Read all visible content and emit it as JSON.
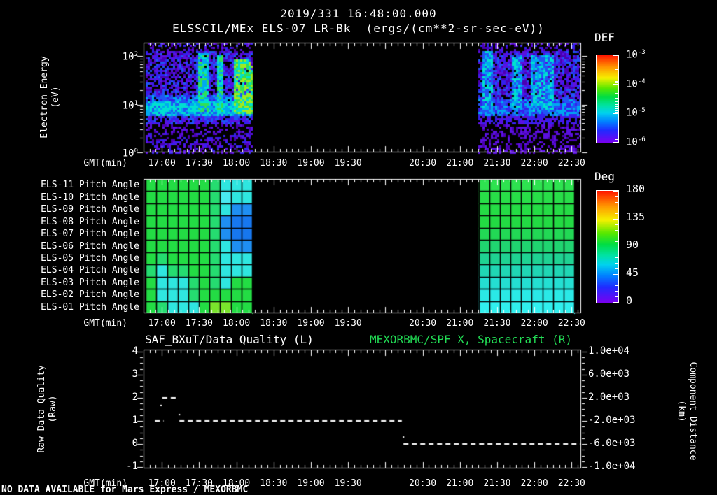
{
  "header": {
    "timestamp": "2019/331 16:48:00.000",
    "dataset": "ELSSCIL/MEx ELS-07 LR-Bk  (ergs/(cm**2-sr-sec-eV))"
  },
  "status_line": "NO DATA AVAILABLE for Mars Express / MEXORBMC",
  "colors": {
    "background": "#000000",
    "text": "#ffffff",
    "accent_green": "#22dd55"
  },
  "chart_data": {
    "time_axis": {
      "xlabel": "GMT(min)",
      "major_start": 0.042,
      "major_step": 0.0851,
      "count": 12,
      "minor_per_major": 6,
      "labels": [
        "17:00",
        "17:30",
        "18:00",
        "18:30",
        "19:00",
        "19:30",
        "",
        "20:30",
        "21:00",
        "21:30",
        "22:00",
        "22:30"
      ]
    },
    "panels": [
      {
        "id": "electron_energy_spectrogram",
        "type": "heatmap",
        "ylabel_lines": [
          "Electron Energy",
          "(eV)"
        ],
        "y_scale": "log",
        "units": "ergs/(cm**2-sr-sec-eV)",
        "y_ticks": [
          {
            "base": "10",
            "exp": "2",
            "frac": 0.121
          },
          {
            "base": "10",
            "exp": "1",
            "frac": 0.567
          },
          {
            "base": "10",
            "exp": "0",
            "frac": 1.0
          }
        ],
        "levels": [
          "#4a00b4",
          "#5a10e0",
          "#3420ee",
          "#1f55f5",
          "#00a8f0",
          "#00e0d0",
          "#30e055",
          "#a0ea20"
        ],
        "regions": [
          {
            "x0": 0.005,
            "x1": 0.248,
            "bands": [
              {
                "y0": 0.0,
                "y1": 0.06,
                "p": 0.3,
                "lv": [
                  1,
                  3
                ]
              },
              {
                "y0": 0.06,
                "y1": 0.46,
                "p": 0.72,
                "lv": [
                  1,
                  4
                ]
              },
              {
                "y0": 0.46,
                "y1": 0.52,
                "p": 0.92,
                "lv": [
                  3,
                  5
                ]
              },
              {
                "y0": 0.52,
                "y1": 0.66,
                "p": 1.0,
                "lv": [
                  4,
                  6
                ]
              },
              {
                "y0": 0.66,
                "y1": 0.73,
                "p": 0.8,
                "lv": [
                  2,
                  4
                ]
              },
              {
                "y0": 0.73,
                "y1": 0.82,
                "p": 0.35,
                "lv": [
                  1,
                  2
                ]
              },
              {
                "y0": 0.82,
                "y1": 1.0,
                "p": 0.45,
                "lv": [
                  1,
                  3
                ]
              }
            ],
            "streaks": [
              {
                "x0": 0.123,
                "x1": 0.146,
                "y0": 0.08,
                "y1": 0.62,
                "lv": [
                  5,
                  7
                ]
              },
              {
                "x0": 0.165,
                "x1": 0.182,
                "y0": 0.1,
                "y1": 0.62,
                "lv": [
                  5,
                  7
                ]
              },
              {
                "x0": 0.205,
                "x1": 0.249,
                "y0": 0.14,
                "y1": 0.64,
                "lv": [
                  6,
                  8
                ]
              }
            ]
          },
          {
            "x0": 0.766,
            "x1": 1.0,
            "bands": [
              {
                "y0": 0.0,
                "y1": 0.06,
                "p": 0.35,
                "lv": [
                  1,
                  3
                ]
              },
              {
                "y0": 0.06,
                "y1": 0.5,
                "p": 0.78,
                "lv": [
                  1,
                  4
                ]
              },
              {
                "y0": 0.5,
                "y1": 0.66,
                "p": 0.95,
                "lv": [
                  3,
                  5
                ]
              },
              {
                "y0": 0.66,
                "y1": 0.74,
                "p": 0.7,
                "lv": [
                  2,
                  3
                ]
              },
              {
                "y0": 0.74,
                "y1": 1.0,
                "p": 0.4,
                "lv": [
                  1,
                  2
                ]
              }
            ],
            "streaks": [
              {
                "x0": 0.77,
                "x1": 0.794,
                "y0": 0.06,
                "y1": 0.6,
                "lv": [
                  4,
                  6
                ]
              },
              {
                "x0": 0.838,
                "x1": 0.862,
                "y0": 0.1,
                "y1": 0.6,
                "lv": [
                  4,
                  6
                ]
              },
              {
                "x0": 0.884,
                "x1": 0.936,
                "y0": 0.1,
                "y1": 0.62,
                "lv": [
                  4,
                  6
                ]
              }
            ]
          }
        ]
      },
      {
        "id": "pitch_angle_grid",
        "type": "heatmap",
        "row_labels": [
          "ELS-11 Pitch Angle",
          "ELS-10 Pitch Angle",
          "ELS-09 Pitch Angle",
          "ELS-08 Pitch Angle",
          "ELS-07 Pitch Angle",
          "ELS-06 Pitch Angle",
          "ELS-05 Pitch Angle",
          "ELS-04 Pitch Angle",
          "ELS-03 Pitch Angle",
          "ELS-02 Pitch Angle",
          "ELS-01 Pitch Angle"
        ],
        "left_block": {
          "x0": 0.005,
          "x1": 0.248,
          "cells": [
            [
              "#23dc44",
              "#23dc44",
              "#23dc44",
              "#23dc44",
              "#23dc44",
              "#23dc44",
              "#25dc70",
              "#2fe6e0",
              "#2fe6e0",
              "#2fe6e0"
            ],
            [
              "#23dc44",
              "#23dc44",
              "#23dc44",
              "#23dc44",
              "#23dc44",
              "#23dc44",
              "#25dc70",
              "#49e9ef",
              "#2fe6e0",
              "#2fe6e0"
            ],
            [
              "#23dc44",
              "#23dc44",
              "#23dc44",
              "#23dc44",
              "#23dc44",
              "#23dc44",
              "#25dc70",
              "#2fe6e0",
              "#1f8ff2",
              "#1f8ff2"
            ],
            [
              "#23dc44",
              "#23dc44",
              "#23dc44",
              "#23dc44",
              "#23dc44",
              "#23dc44",
              "#25dc70",
              "#1f8ff2",
              "#1777ee",
              "#1777ee"
            ],
            [
              "#23dc44",
              "#23dc44",
              "#23dc44",
              "#23dc44",
              "#23dc44",
              "#23dc44",
              "#25dc70",
              "#1f8ff2",
              "#1777ee",
              "#1777ee"
            ],
            [
              "#23dc44",
              "#23dc44",
              "#23dc44",
              "#23dc44",
              "#23dc44",
              "#23dc44",
              "#25dc70",
              "#2fe6e0",
              "#1f8ff2",
              "#1f8ff2"
            ],
            [
              "#23dc44",
              "#25dc70",
              "#23dc44",
              "#23dc44",
              "#23dc44",
              "#23dc44",
              "#25dc70",
              "#2fe6e0",
              "#2fe6e0",
              "#2fe6e0"
            ],
            [
              "#25dc70",
              "#2fe6e0",
              "#25dc70",
              "#25dc70",
              "#23dc44",
              "#23dc44",
              "#25dc70",
              "#2fe6e0",
              "#2fe6e0",
              "#2fe6e0"
            ],
            [
              "#23dc44",
              "#2fe6e0",
              "#2fe6e0",
              "#2fe6e0",
              "#25dc70",
              "#23dc44",
              "#25dc70",
              "#2fe6e0",
              "#23dc44",
              "#23dc44"
            ],
            [
              "#23dc44",
              "#2fe6e0",
              "#2fe6e0",
              "#2fe6e0",
              "#25dc70",
              "#23dc44",
              "#23dc44",
              "#23dc44",
              "#23dc44",
              "#23dc44"
            ],
            [
              "#23dc44",
              "#25dc70",
              "#2fe6e0",
              "#2fe6e0",
              "#2fe6e0",
              "#23dc44",
              "#7ae42c",
              "#7ae42c",
              "#23dc44",
              "#23dc44"
            ]
          ]
        },
        "right_block": {
          "x0": 0.766,
          "x1": 0.984,
          "cols": 9,
          "row_colors": [
            "#2ee350",
            "#28de48",
            "#25dc45",
            "#23da43",
            "#22d855",
            "#20d470",
            "#1fd292",
            "#20d6b4",
            "#24dfd2",
            "#2ae9e6",
            "#30efee"
          ]
        }
      },
      {
        "id": "data_quality_line",
        "type": "line",
        "title_left": "SAF_BXuT/Data Quality (L)",
        "title_right": "MEXORBMC/SPF X, Spacecraft (R)",
        "ylabel_left_lines": [
          "Raw Data Quality",
          "(Raw)"
        ],
        "ylabel_right_lines": [
          "Component Distance",
          "(km)"
        ],
        "y_left": {
          "ticks": [
            "4",
            "3",
            "2",
            "1",
            "0",
            "-1"
          ],
          "top_value": 4.09,
          "bottom_value": -1.06,
          "minor_step": 0.25
        },
        "y_right": {
          "ticks": [
            "1.0e+04",
            "6.0e+03",
            "2.0e+03",
            "-2.0e+03",
            "-6.0e+03",
            "-1.0e+04"
          ]
        },
        "segments": [
          {
            "y": 2,
            "x0": 0.043,
            "x1": 0.08
          },
          {
            "y": 1,
            "x0": 0.026,
            "x1": 0.046
          },
          {
            "y": 1,
            "x0": 0.082,
            "x1": 0.59
          },
          {
            "y": 0,
            "x0": 0.594,
            "x1": 1.0
          }
        ],
        "points": [
          [
            0.04,
            1.67
          ],
          [
            0.082,
            1.27
          ],
          [
            0.594,
            0.3
          ]
        ],
        "dash": [
          7,
          5
        ],
        "right_series_note": "NO DATA AVAILABLE for Mars Express / MEXORBMC"
      }
    ],
    "colorbars": [
      {
        "id": "def",
        "title": "DEF",
        "labels": [
          {
            "base": "10",
            "exp": "-3"
          },
          {
            "base": "10",
            "exp": "-4"
          },
          {
            "base": "10",
            "exp": "-5"
          },
          {
            "base": "10",
            "exp": "-6"
          }
        ],
        "gradient": [
          "#ff1500 0%",
          "#ff9900 14%",
          "#f5f000 26%",
          "#55e800 38%",
          "#00dd44 48%",
          "#00e2a6 58%",
          "#00d2ee 66%",
          "#0080ff 76%",
          "#1f2bff 86%",
          "#7a00f0 100%"
        ]
      },
      {
        "id": "deg",
        "title": "Deg",
        "labels": [
          "180",
          "135",
          "90",
          "45",
          "0"
        ],
        "gradient": [
          "#ff1500 0%",
          "#ff9900 14%",
          "#f5f000 26%",
          "#55e800 38%",
          "#00dd44 48%",
          "#00e2a6 58%",
          "#00d2ee 66%",
          "#0080ff 76%",
          "#1f2bff 86%",
          "#7a00f0 100%"
        ]
      }
    ]
  }
}
